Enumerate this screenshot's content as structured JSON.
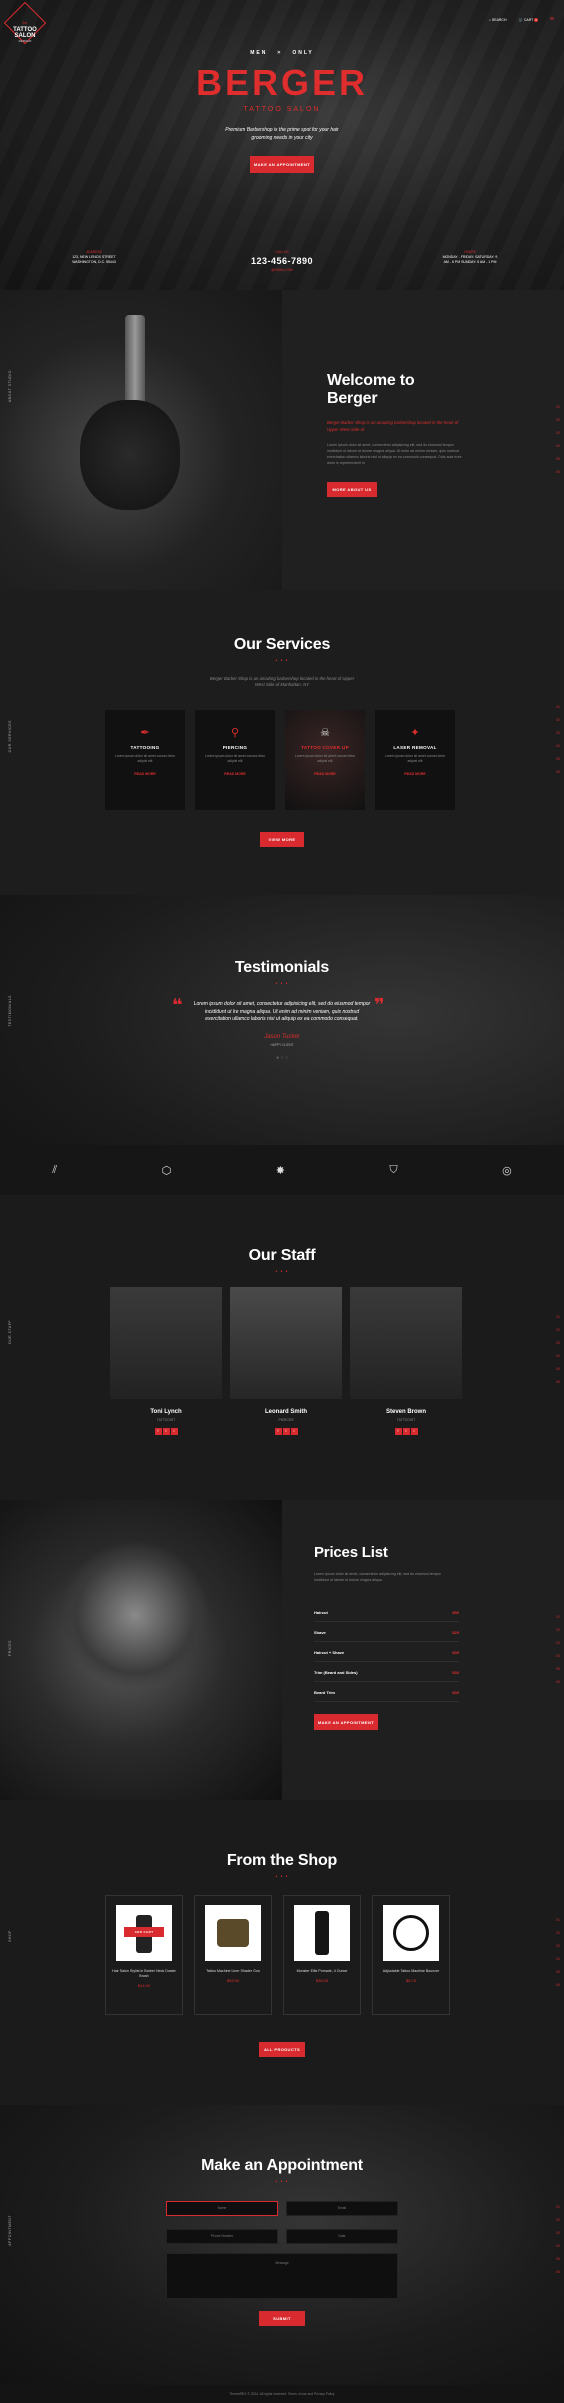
{
  "nav": {
    "logo": "TATTOO SALON",
    "logo_sub": "BERGER",
    "search": "SEARCH",
    "cart": "CART",
    "cart_count": "0",
    "menu_icon": "hamburger-icon"
  },
  "hero": {
    "kicker_left": "MEN",
    "kicker_right": "ONLY",
    "title": "BERGER",
    "subtitle": "TATTOO SALON",
    "tagline": "Premium Barbershop is the prime spot for your hair grooming needs in your city",
    "cta": "MAKE AN APPOINTMENT",
    "address_label": "ADDRESS",
    "address": "123, NEW LENOX STREET WASHINGTON, D.C. 55443",
    "phone_label": "CALL US",
    "phone": "123-456-7890",
    "email": "@GMAIL.COM",
    "hours_label": "HOURS",
    "hours": "MONDAY - FRIDAY: SATURDAY: 9 AM - 6 PM SUNDAY: 9 AM - 1 PM"
  },
  "welcome": {
    "side": "ABOUT STUDIO",
    "title": "Welcome to Berger",
    "lead": "Berger Barber Shop is an amazing barbershop located in the heart of Upper West Side of",
    "body": "Lorem ipsum dolor sit amet, consectetur adipisicing elit, sed do eiusmod tempor incididunt ut labore et dolore magna aliqua. Ut enim ad minim veniam, quis nostrud exercitation ullamco laboris nisi ut aliquip ex ea commodo consequat. Duis aute irure dolor in reprehenderit in",
    "cta": "MORE ABOUT US",
    "pager": [
      "01",
      "02",
      "03",
      "04",
      "05",
      "06"
    ]
  },
  "services": {
    "side": "OUR SERVICES",
    "title": "Our Services",
    "lead": "Berger Barber Shop is an amazing barbershop located in the heart of Upper West Side of Manhattan, NY",
    "items": [
      {
        "name": "TATTOOING",
        "icon": "tattoo-machine-icon",
        "desc": "Lorem ipsum dolor sit amet consec tetur adipisi elit",
        "more": "READ MORE"
      },
      {
        "name": "PIERCING",
        "icon": "piercing-icon",
        "desc": "Lorem ipsum dolor sit amet consec tetur adipisi elit",
        "more": "READ MORE"
      },
      {
        "name": "TATTOO COVER UP",
        "icon": "skull-icon",
        "desc": "Lorem ipsum dolor sit amet consec tetur adipisi elit",
        "more": "READ MORE"
      },
      {
        "name": "LASER REMOVAL",
        "icon": "laser-icon",
        "desc": "Lorem ipsum dolor sit amet consec tetur adipisi elit",
        "more": "READ MORE"
      }
    ],
    "cta": "VIEW MORE",
    "pager": [
      "01",
      "02",
      "03",
      "04",
      "05",
      "06"
    ]
  },
  "testimonials": {
    "side": "TESTIMONIALS",
    "title": "Testimonials",
    "quote": "Lorem ipsum dolor sit amet, consectetur adipisicing elit, sed do eiusmod tempor incididunt ut lre magna aliqua. Ut enim ad minim veniam, quis nostrud exercitation ullamco laboris nisi ut aliquip ex ea commodo consequat.",
    "author": "Jason Tucker",
    "role": "HAPPY CLIENT",
    "brands": [
      "brand-stripes-icon",
      "brand-badge-icon",
      "brand-splash-icon",
      "brand-shield-icon",
      "brand-circle-icon"
    ]
  },
  "staff": {
    "side": "OUR STAFF",
    "title": "Our Staff",
    "members": [
      {
        "name": "Toni Lynch",
        "role": "TATTOOIST"
      },
      {
        "name": "Leonard Smith",
        "role": "PIERCER"
      },
      {
        "name": "Steven Brown",
        "role": "TATTOOIST"
      }
    ],
    "social": [
      "f",
      "t",
      "i"
    ],
    "pager": [
      "01",
      "02",
      "03",
      "04",
      "05",
      "06"
    ]
  },
  "prices": {
    "side": "PRICES",
    "title": "Prices List",
    "lead": "Lorem ipsum dolor sit amet, consectetur adipisicing elit, sed do eiusmod tempor incididunt ut labore et dolore magna aliqua.",
    "items": [
      {
        "name": "Haircut",
        "price": "$50"
      },
      {
        "name": "Shave",
        "price": "$25"
      },
      {
        "name": "Haircut + Shave",
        "price": "$35"
      },
      {
        "name": "Trim (Beard and Sides)",
        "price": "$30"
      },
      {
        "name": "Beard Trim",
        "price": "$30"
      }
    ],
    "cta": "MAKE AN APPOINTMENT",
    "pager": [
      "01",
      "02",
      "03",
      "04",
      "05",
      "06"
    ]
  },
  "shop": {
    "side": "SHOP",
    "title": "From the Shop",
    "products": [
      {
        "name": "Hair Salon Stylist in Barber Neck Duster Brush",
        "price": "$14.00",
        "sale": "ADD CART"
      },
      {
        "name": "Tattoo Machine Liner Shader Gun",
        "price": "$53.00"
      },
      {
        "name": "Monster Ellie Pomade, 4 Ounce",
        "price": "$38.00"
      },
      {
        "name": "Adjustable Tattoo Machine Bouncer",
        "price": "$8.75"
      }
    ],
    "cta": "ALL PRODUCTS",
    "pager": [
      "01",
      "02",
      "03",
      "04",
      "05",
      "06"
    ]
  },
  "appointment": {
    "side": "APPOINTMENT",
    "title": "Make an Appointment",
    "f_name": "Name",
    "f_email": "Email",
    "f_phone": "Phone Number",
    "f_date": "Date",
    "f_message": "Message",
    "cta": "SUBMIT",
    "pager": [
      "01",
      "02",
      "03",
      "04",
      "05",
      "06"
    ]
  },
  "footer": {
    "text": "ThemeREX © 2024. All rights reserved. Terms of use and Privacy Policy"
  },
  "colors": {
    "accent": "#d92b2f",
    "bg": "#1b1b1b"
  }
}
